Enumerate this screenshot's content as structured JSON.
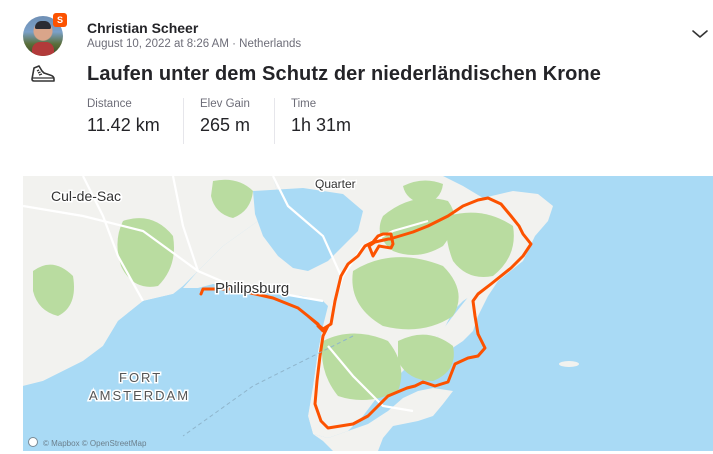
{
  "athlete": {
    "name": "Christian Scheer",
    "badge": "S"
  },
  "activity": {
    "meta": "August 10, 2022 at 8:26 AM · Netherlands",
    "title": "Laufen unter dem Schutz der niederländischen Krone",
    "type_icon": "shoe-icon"
  },
  "stats": [
    {
      "label": "Distance",
      "value": "11.42 km"
    },
    {
      "label": "Elev Gain",
      "value": "265 m"
    },
    {
      "label": "Time",
      "value": "1h 31m"
    }
  ],
  "map": {
    "labels": {
      "quarter": "Quarter",
      "cul_de_sac": "Cul-de-Sac",
      "philipsburg": "Philipsburg",
      "fort": "FORT",
      "amsterdam": "AMSTERDAM"
    },
    "attribution": "© Mapbox © OpenStreetMap",
    "route_color": "#fc5200",
    "water_color": "#a9daf5",
    "land_color": "#f2f2ef",
    "hill_color": "#b9dca0"
  },
  "menu": {
    "icon": "chevron-down-icon"
  }
}
